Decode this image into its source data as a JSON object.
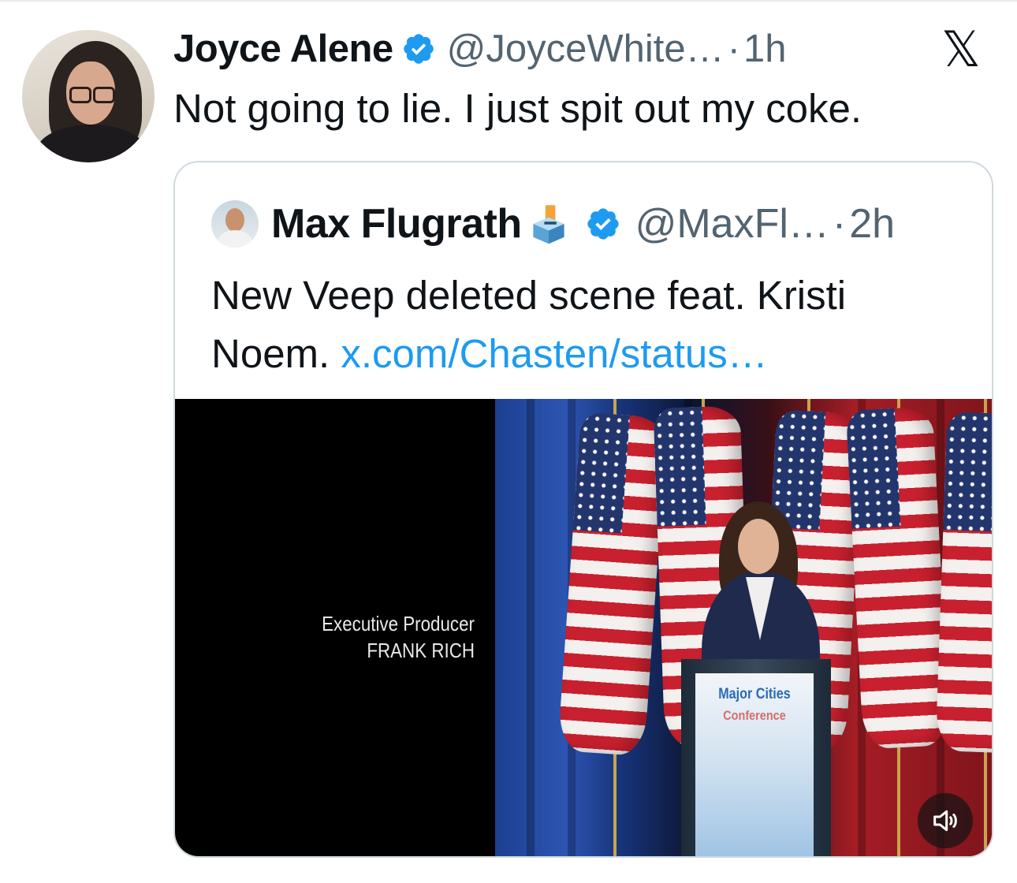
{
  "tweet": {
    "author_name": "Joyce Alene",
    "handle": "@JoyceWhite…",
    "separator": "·",
    "time": "1h",
    "text": "Not going to lie. I just spit out my coke.",
    "platform_logo": "𝕏"
  },
  "quoted_tweet": {
    "author_name": "Max Flugrath",
    "handle": "@MaxFl…",
    "separator": "·",
    "time": "2h",
    "text": "New Veep deleted scene feat. Kristi Noem.",
    "link": "x.com/Chasten/status…",
    "media": {
      "credits_line1": "Executive Producer",
      "credits_line2": "FRANK RICH",
      "podium_line1": "Major Cities",
      "podium_line2": "Conference"
    }
  },
  "colors": {
    "verified": "#1d9bf0",
    "link": "#1d9bf0",
    "secondary_text": "#536471",
    "border": "#cfd9de"
  },
  "icons": {
    "verified": "verified-badge-icon",
    "ballot": "ballot-box-icon",
    "logo": "x-logo-icon",
    "audio": "volume-icon"
  }
}
